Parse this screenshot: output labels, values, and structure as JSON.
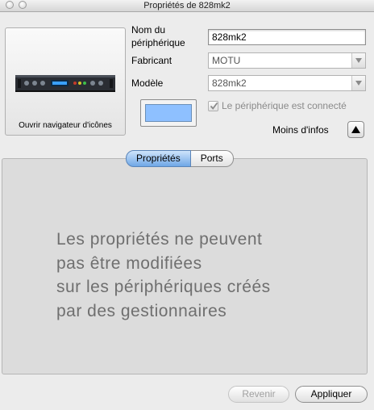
{
  "window": {
    "title": "Propriétés de 828mk2"
  },
  "icon_well": {
    "label": "Ouvrir navigateur d'icônes",
    "device_icon": "rack-interface-icon"
  },
  "fields": {
    "name_label_line1": "Nom du",
    "name_label_line2": "périphérique",
    "name_value": "828mk2",
    "manufacturer_label": "Fabricant",
    "manufacturer_value": "MOTU",
    "model_label": "Modèle",
    "model_value": "828mk2"
  },
  "color_well": {
    "color": "#8ec0ff"
  },
  "connected": {
    "label": "Le périphérique est connecté",
    "checked": true
  },
  "info_toggle": {
    "label": "Moins d'infos",
    "icon": "triangle-up-icon"
  },
  "tabs": [
    {
      "label": "Propriétés",
      "selected": true
    },
    {
      "label": "Ports",
      "selected": false
    }
  ],
  "message_lines": [
    "Les propriétés ne peuvent",
    "pas être modifiées",
    "sur les périphériques créés",
    "par des gestionnaires"
  ],
  "buttons": {
    "revert_label": "Revenir",
    "apply_label": "Appliquer"
  }
}
